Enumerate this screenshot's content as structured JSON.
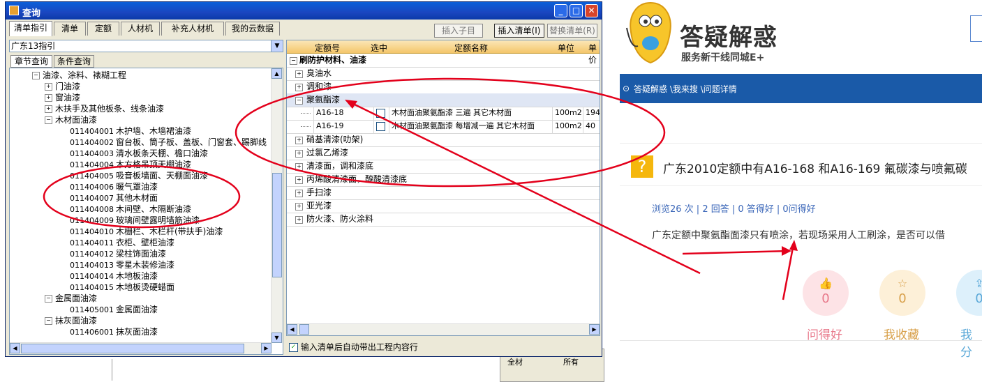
{
  "dialog": {
    "title": "查询",
    "tabs": [
      "清单指引",
      "清单",
      "定额",
      "人材机",
      "补充人材机",
      "我的云数据"
    ],
    "buttons": {
      "insert_child": "插入子目",
      "insert_list": "插入清单(I)",
      "replace_list": "替换清单(R)"
    },
    "controls": {
      "minimize": "_",
      "maximize": "□",
      "close": "✕"
    }
  },
  "left": {
    "combo_value": "广东13指引",
    "subtabs": [
      "章节查询",
      "条件查询"
    ],
    "tree": [
      {
        "indent": 0,
        "exp": "−",
        "code": "",
        "label": "油漆、涂料、裱糊工程"
      },
      {
        "indent": 1,
        "exp": "+",
        "code": "",
        "label": "门油漆"
      },
      {
        "indent": 1,
        "exp": "+",
        "code": "",
        "label": "窗油漆"
      },
      {
        "indent": 1,
        "exp": "+",
        "code": "",
        "label": "木扶手及其他板条、线条油漆"
      },
      {
        "indent": 1,
        "exp": "−",
        "code": "",
        "label": "木材面油漆"
      },
      {
        "indent": 2,
        "exp": "",
        "code": "011404001",
        "label": "木护墙、木墙裙油漆"
      },
      {
        "indent": 2,
        "exp": "",
        "code": "011404002",
        "label": "窗台板、筒子板、盖板、门窗套、踢脚线"
      },
      {
        "indent": 2,
        "exp": "",
        "code": "011404003",
        "label": "清水板条天棚、檐口油漆"
      },
      {
        "indent": 2,
        "exp": "",
        "code": "011404004",
        "label": "木方格吊顶天棚油漆"
      },
      {
        "indent": 2,
        "exp": "",
        "code": "011404005",
        "label": "吸音板墙面、天棚面油漆"
      },
      {
        "indent": 2,
        "exp": "",
        "code": "011404006",
        "label": "暖气罩油漆"
      },
      {
        "indent": 2,
        "exp": "",
        "code": "011404007",
        "label": "其他木材面"
      },
      {
        "indent": 2,
        "exp": "",
        "code": "011404008",
        "label": "木间壁、木隔断油漆"
      },
      {
        "indent": 2,
        "exp": "",
        "code": "011404009",
        "label": "玻璃间壁露明墙筋油漆"
      },
      {
        "indent": 2,
        "exp": "",
        "code": "011404010",
        "label": "木栅栏、木栏杆(带扶手)油漆"
      },
      {
        "indent": 2,
        "exp": "",
        "code": "011404011",
        "label": "衣柜、壁柜油漆"
      },
      {
        "indent": 2,
        "exp": "",
        "code": "011404012",
        "label": "梁柱饰面油漆"
      },
      {
        "indent": 2,
        "exp": "",
        "code": "011404013",
        "label": "零星木装修油漆"
      },
      {
        "indent": 2,
        "exp": "",
        "code": "011404014",
        "label": "木地板油漆"
      },
      {
        "indent": 2,
        "exp": "",
        "code": "011404015",
        "label": "木地板烫硬蜡面"
      },
      {
        "indent": 1,
        "exp": "−",
        "code": "",
        "label": "金属面油漆"
      },
      {
        "indent": 2,
        "exp": "",
        "code": "011405001",
        "label": "金属面油漆"
      },
      {
        "indent": 1,
        "exp": "−",
        "code": "",
        "label": "抹灰面油漆"
      },
      {
        "indent": 2,
        "exp": "",
        "code": "011406001",
        "label": "抹灰面油漆"
      }
    ]
  },
  "grid": {
    "headers": [
      "定额号",
      "选中",
      "定额名称",
      "单位",
      "单价"
    ],
    "group_title": "刷防护材料、油漆",
    "rows": [
      {
        "type": "group",
        "exp": "+",
        "label": "臭油水"
      },
      {
        "type": "group",
        "exp": "+",
        "label": "调和漆"
      },
      {
        "type": "group",
        "exp": "−",
        "label": "聚氨酯漆"
      },
      {
        "type": "item",
        "code": "A16-18",
        "name": "木材面油聚氨酯漆 三遍 其它木材面",
        "unit": "100m2",
        "price": "194"
      },
      {
        "type": "item",
        "code": "A16-19",
        "name": "木材面油聚氨酯漆 每增减一遍 其它木材面",
        "unit": "100m2",
        "price": "40"
      },
      {
        "type": "group",
        "exp": "+",
        "label": "硝基清漆(叻架)"
      },
      {
        "type": "group",
        "exp": "+",
        "label": "过氯乙烯漆"
      },
      {
        "type": "group",
        "exp": "+",
        "label": "清漆面，调和漆底"
      },
      {
        "type": "group",
        "exp": "+",
        "label": "丙烯酸清漆面，醇酸清漆底"
      },
      {
        "type": "group",
        "exp": "+",
        "label": "手扫漆"
      },
      {
        "type": "group",
        "exp": "+",
        "label": "亚光漆"
      },
      {
        "type": "group",
        "exp": "+",
        "label": "防火漆、防火涂料"
      }
    ],
    "bottom_check": "输入清单后自动带出工程内容行"
  },
  "background": {
    "radio1": "全材",
    "radio2": "所有"
  },
  "web": {
    "brand": "答疑解惑",
    "slogan": "服务新干线同城E+",
    "breadcrumb": "答疑解惑 \\我来搜 \\问题详情",
    "question_title": "广东2010定额中有A16-168 和A16-169 氟碳漆与喷氟碳",
    "stats": "浏览26 次 | 2 回答 | 0 答得好 | 0问得好",
    "body": "广东定额中聚氨酯面漆只有喷涂，若现场采用人工刷涂，是否可以借",
    "actions": [
      {
        "label": "问得好",
        "count": "0",
        "color": "#e8788a",
        "bg": "#fde3e6"
      },
      {
        "label": "我收藏",
        "count": "0",
        "color": "#d8a04a",
        "bg": "#fdf0d8"
      },
      {
        "label": "我分",
        "count": "0",
        "color": "#5aa8d8",
        "bg": "#ddf0fb"
      }
    ],
    "colors": {
      "nav": "#1a5aa8",
      "accent_red": "#e3001b"
    }
  }
}
